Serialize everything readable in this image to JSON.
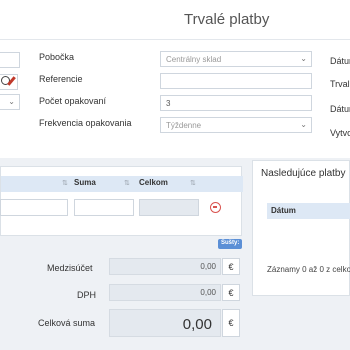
{
  "header": {
    "title": "Trvalé platby"
  },
  "form": {
    "pobocka_label": "Pobočka",
    "pobocka_value": "Centrálny sklad",
    "referencie_label": "Referencie",
    "referencie_value": "",
    "pocet_label": "Počet opakovaní",
    "pocet_value": "3",
    "frekvencia_label": "Frekvencia opakovania",
    "frekvencia_value": "Týždenne",
    "right_labels": [
      "Dátum",
      "Trvalá",
      "Dátum",
      "Vytvo"
    ]
  },
  "items_table": {
    "columns": [
      "Suma",
      "Celkom"
    ]
  },
  "next_payments": {
    "title": "Nasledujúce platby",
    "column": "Dátum",
    "records_text": "Záznamy 0 až 0 z celko"
  },
  "sums": {
    "badge": "Sušty:",
    "medzisucet_label": "Medzisúčet",
    "medzisucet_value": "0,00",
    "dph_label": "DPH",
    "dph_value": "0,00",
    "celkova_label": "Celková suma",
    "celkova_value": "0,00",
    "currency": "€"
  }
}
